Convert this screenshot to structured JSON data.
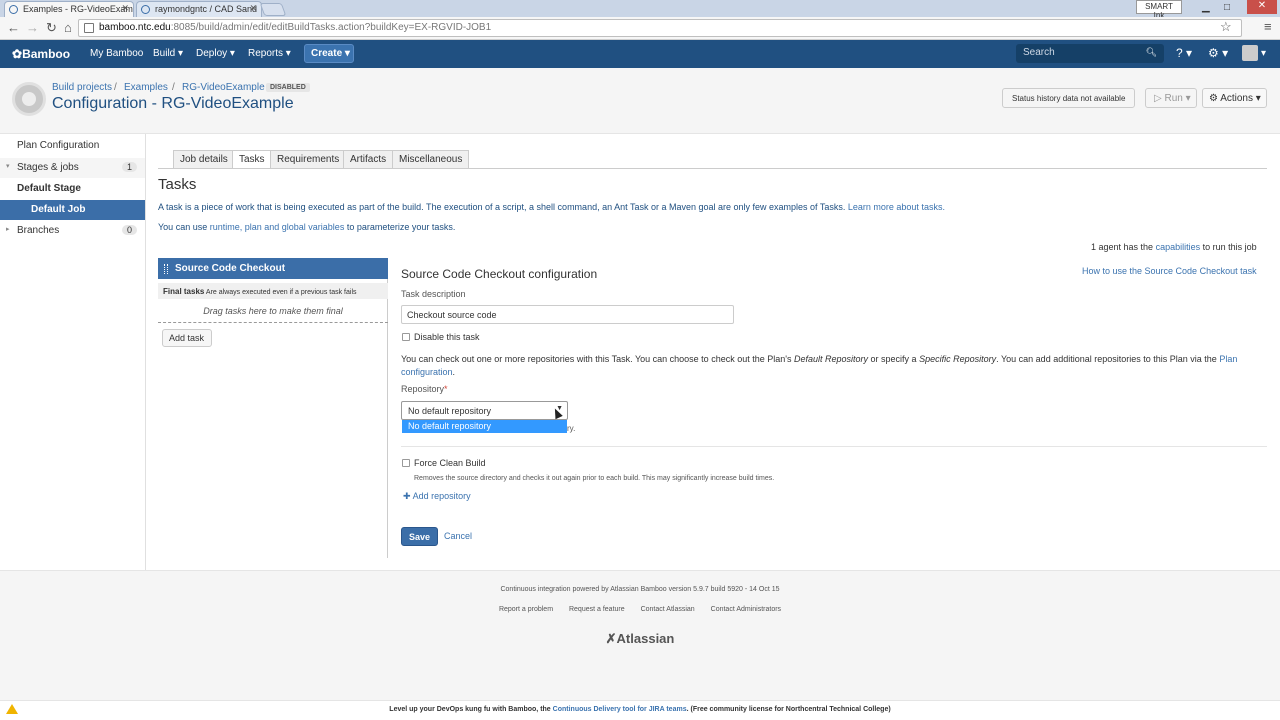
{
  "browser": {
    "tabs": [
      {
        "label": "Examples - RG-VideoExam"
      },
      {
        "label": "raymondgntc / CAD Sand"
      }
    ],
    "url_host": "bamboo.ntc.edu",
    "url_rest": ":8085/build/admin/edit/editBuildTasks.action?buildKey=EX-RGVID-JOB1",
    "smart_ink": "SMART Ink"
  },
  "header": {
    "logo": "Bamboo",
    "nav": [
      "My Bamboo",
      "Build",
      "Deploy",
      "Reports"
    ],
    "create": "Create",
    "search_placeholder": "Search",
    "brand_color": "#205081"
  },
  "page": {
    "breadcrumbs": [
      "Build projects",
      "Examples",
      "RG-VideoExample"
    ],
    "disabled": "DISABLED",
    "title": "Configuration - RG-VideoExample",
    "status_history": "Status history data not available",
    "run": "Run",
    "actions": "Actions"
  },
  "sidebar": {
    "plan_configuration": "Plan Configuration",
    "stages_jobs": "Stages & jobs",
    "stages_count": "1",
    "default_stage": "Default Stage",
    "default_job": "Default Job",
    "branches": "Branches",
    "branches_count": "0"
  },
  "tabs": [
    "Job details",
    "Tasks",
    "Requirements",
    "Artifacts",
    "Miscellaneous"
  ],
  "tasks": {
    "heading": "Tasks",
    "desc1_a": "A task is a piece of work that is being executed as part of the build. The execution of a script, a shell command, an Ant Task or a Maven goal are only few examples of Tasks.",
    "desc1_link": "Learn more about tasks.",
    "desc2_a": "You can use",
    "desc2_link": "runtime, plan and global variables",
    "desc2_b": "to parameterize your tasks.",
    "agent_a": "1 agent has the",
    "agent_link": "capabilities",
    "agent_b": "to run this job",
    "task_item": "Source Code Checkout",
    "final_tasks": "Final tasks",
    "final_note": "Are always executed even if a previous task fails",
    "drag_here": "Drag tasks here to make them final",
    "add_task": "Add task"
  },
  "config": {
    "title": "Source Code Checkout configuration",
    "howto": "How to use the Source Code Checkout task",
    "task_desc_label": "Task description",
    "task_desc_value": "Checkout source code",
    "disable_task": "Disable this task",
    "repo_info_1": "You can check out one or more repositories with this Task. You can choose to check out the Plan's",
    "repo_info_em1": "Default Repository",
    "repo_info_2": "or specify a",
    "repo_info_em2": "Specific Repository",
    "repo_info_3": ". You can add additional repositories to this Plan via the",
    "repo_info_link": "Plan configuration",
    "repo_label": "Repository",
    "repo_selected": "No default repository",
    "repo_option": "No default repository",
    "repo_tail": "ry.",
    "force_clean": "Force Clean Build",
    "force_note": "Removes the source directory and checks it out again prior to each build. This may significantly increase build times.",
    "add_repo": "Add repository",
    "save": "Save",
    "cancel": "Cancel"
  },
  "footer": {
    "powered": "Continuous integration powered by Atlassian Bamboo version 5.9.7 build 5920 - 14 Oct 15",
    "links": [
      "Report a problem",
      "Request a feature",
      "Contact Atlassian",
      "Contact Administrators"
    ],
    "atlassian": "Atlassian",
    "banner_a": "Level up your DevOps kung fu with Bamboo, the",
    "banner_link": "Continuous Delivery tool for JIRA teams",
    "banner_b": ". (Free community license for Northcentral Technical College)"
  }
}
